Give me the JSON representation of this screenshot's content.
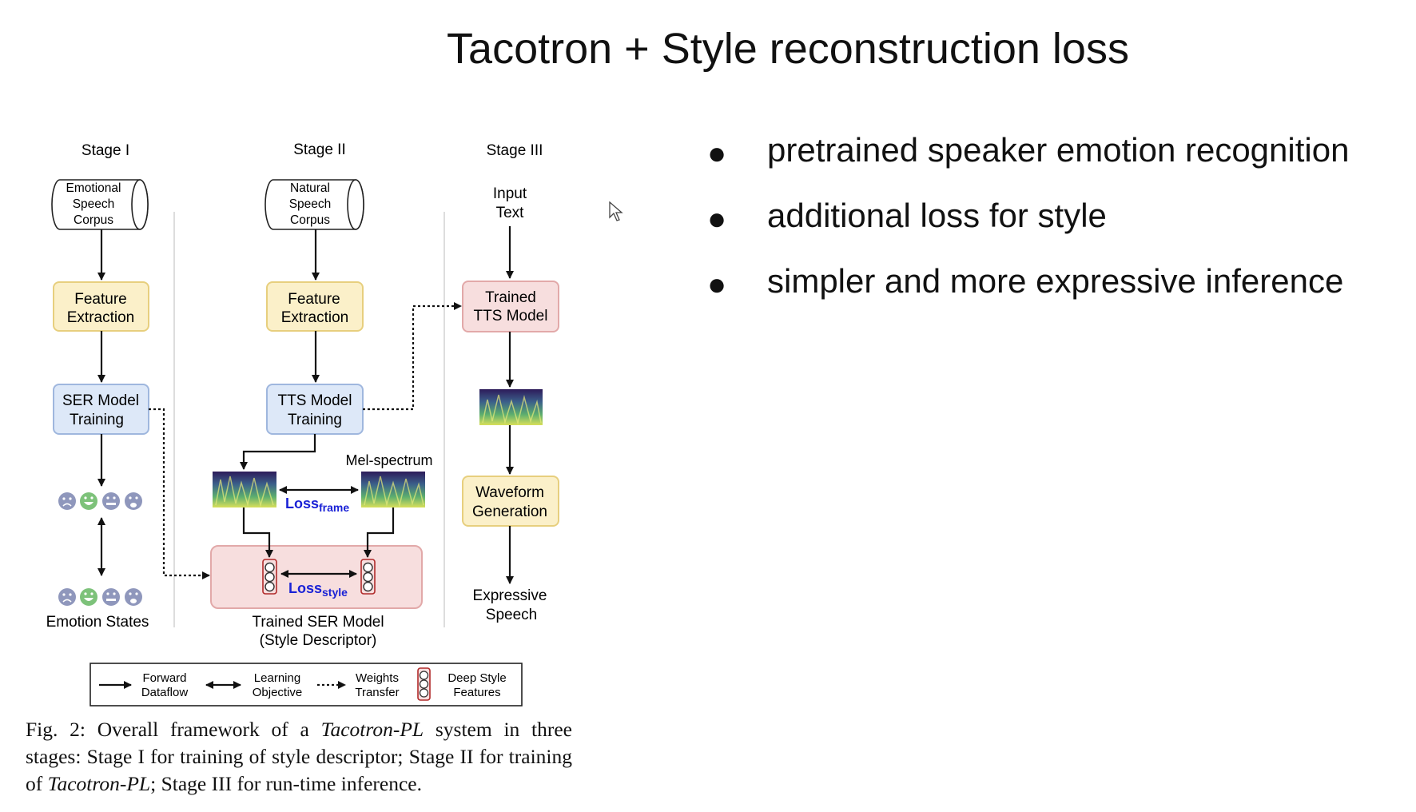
{
  "slide": {
    "title": "Tacotron + Style reconstruction loss",
    "bullets": [
      "pretrained speaker emotion recognition",
      "additional loss for style",
      "simpler and more expressive inference"
    ]
  },
  "figure": {
    "stages": [
      "Stage I",
      "Stage II",
      "Stage III"
    ],
    "stage1": {
      "corpus": [
        "Emotional",
        "Speech",
        "Corpus"
      ],
      "feature": [
        "Feature",
        "Extraction"
      ],
      "model": [
        "SER Model",
        "Training"
      ],
      "bottom_label": "Emotion States"
    },
    "stage2": {
      "corpus": [
        "Natural",
        "Speech",
        "Corpus"
      ],
      "feature": [
        "Feature",
        "Extraction"
      ],
      "model": [
        "TTS Model",
        "Training"
      ],
      "mel_label": "Mel-spectrum",
      "loss_frame_main": "Loss",
      "loss_frame_sub": "frame",
      "loss_style_main": "Loss",
      "loss_style_sub": "style",
      "ser_label": [
        "Trained SER Model",
        "(Style Descriptor)"
      ]
    },
    "stage3": {
      "input": [
        "Input",
        "Text"
      ],
      "model": [
        "Trained",
        "TTS Model"
      ],
      "waveform": [
        "Waveform",
        "Generation"
      ],
      "output": [
        "Expressive",
        "Speech"
      ]
    },
    "legend": {
      "forward": [
        "Forward",
        "Dataflow"
      ],
      "learning": [
        "Learning",
        "Objective"
      ],
      "weights": [
        "Weights",
        "Transfer"
      ],
      "deep": [
        "Deep Style",
        "Features"
      ]
    },
    "caption": {
      "p1": "Fig. 2: Overall framework of a ",
      "i1": "Tacotron-PL",
      "p2": " system in three stages: Stage I for training of style descriptor; Stage II for training of ",
      "i2": "Tacotron-PL",
      "p3": "; Stage III for run-time inference."
    },
    "colors": {
      "feature_fill": "#fbf0c9",
      "feature_stroke": "#e7cf7e",
      "model_fill": "#dde8f8",
      "model_stroke": "#9fb7de",
      "trained_fill": "#f7dede",
      "trained_stroke": "#e2a9a9",
      "loss_text": "#1a22d6",
      "face": "#8f97bc",
      "face_happy": "#7dc27a"
    }
  }
}
